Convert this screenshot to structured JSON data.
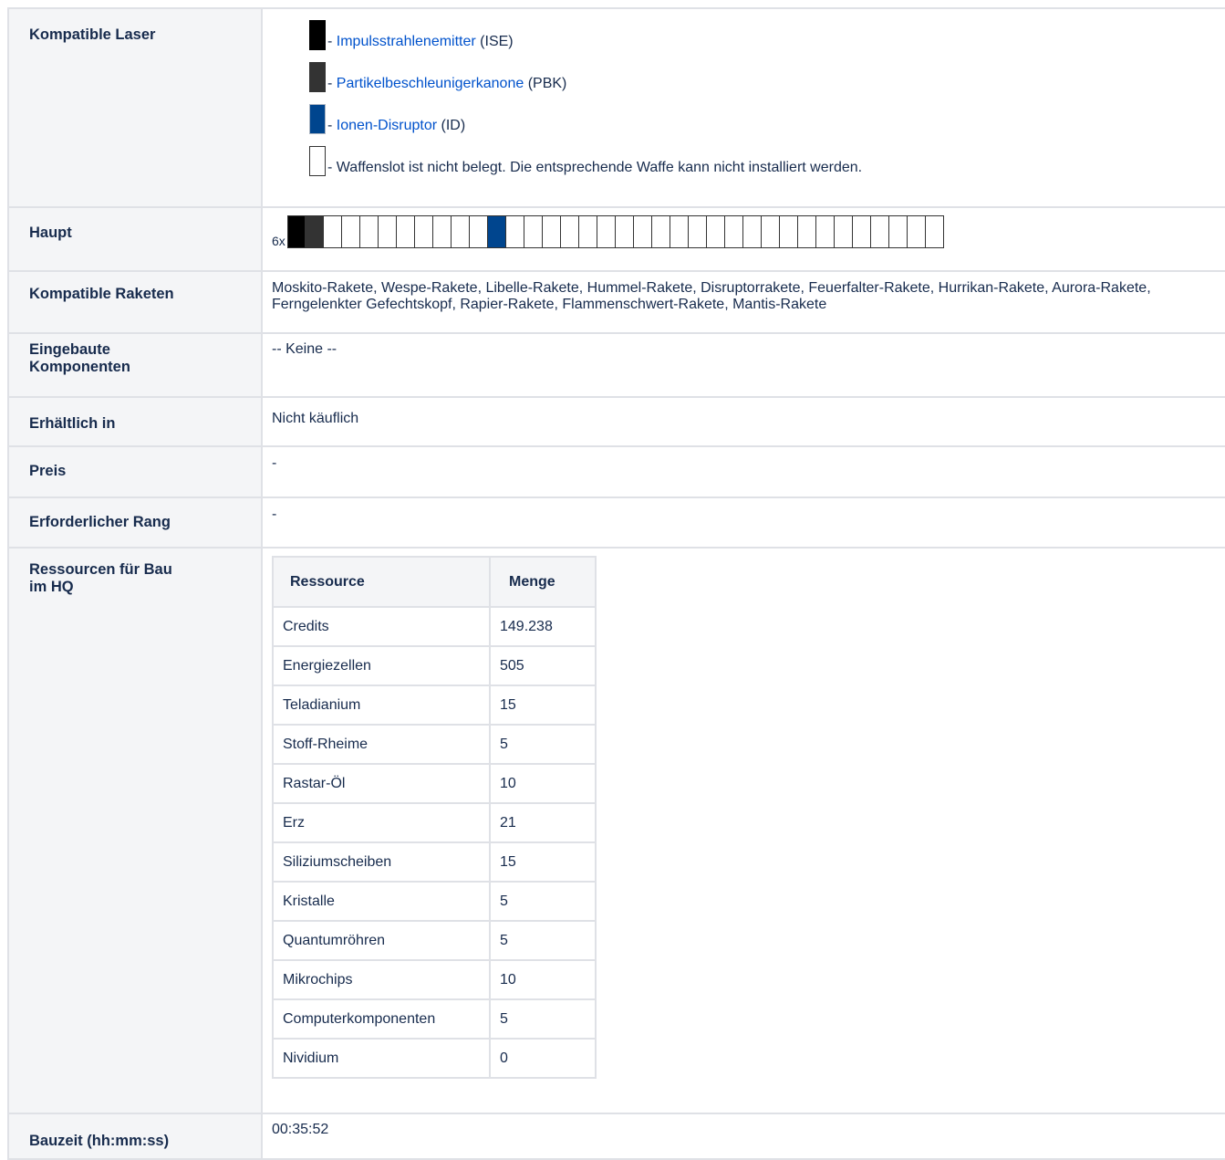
{
  "rows": {
    "kompatible_laser": {
      "label": "Kompatible Laser",
      "legend": [
        {
          "color": "#000000",
          "sep": "- ",
          "link": "Impulsstrahlenemitter",
          "suffix": " (ISE)"
        },
        {
          "color": "#333333",
          "sep": "- ",
          "link": "Partikelbeschleunigerkanone",
          "suffix": " (PBK)"
        },
        {
          "color": "#00458e",
          "sep": "- ",
          "link": "Ionen-Disruptor",
          "suffix": " (ID)"
        },
        {
          "color": "#ffffff",
          "sep": "- ",
          "text": "Waffenslot ist nicht belegt. Die entsprechende Waffe kann nicht installiert werden."
        }
      ]
    },
    "haupt": {
      "label": "Haupt",
      "count": "6x",
      "slots": [
        "#000000",
        "#333333",
        "#ffffff",
        "#ffffff",
        "#ffffff",
        "#ffffff",
        "#ffffff",
        "#ffffff",
        "#ffffff",
        "#ffffff",
        "#ffffff",
        "#00458e",
        "#ffffff",
        "#ffffff",
        "#ffffff",
        "#ffffff",
        "#ffffff",
        "#ffffff",
        "#ffffff",
        "#ffffff",
        "#ffffff",
        "#ffffff",
        "#ffffff",
        "#ffffff",
        "#ffffff",
        "#ffffff",
        "#ffffff",
        "#ffffff",
        "#ffffff",
        "#ffffff",
        "#ffffff",
        "#ffffff",
        "#ffffff",
        "#ffffff",
        "#ffffff",
        "#ffffff"
      ]
    },
    "raketen": {
      "label": "Kompatible Raketen",
      "value": "Moskito-Rakete, Wespe-Rakete, Libelle-Rakete, Hummel-Rakete, Disruptorrakete, Feuerfalter-Rakete, Hurrikan-Rakete, Aurora-Rakete, Ferngelenkter Gefechtskopf, Rapier-Rakete, Flammenschwert-Rakete, Mantis-Rakete"
    },
    "komponenten": {
      "label": "Eingebaute Komponenten",
      "value": "-- Keine --"
    },
    "erhaeltlich": {
      "label": "Erhältlich in",
      "value": "Nicht käuflich"
    },
    "preis": {
      "label": "Preis",
      "value": "-"
    },
    "rang": {
      "label": "Erforderlicher Rang",
      "value": "-"
    },
    "ressourcen": {
      "label": "Ressourcen für Bau im HQ",
      "header": {
        "name": "Ressource",
        "amount": "Menge"
      },
      "items": [
        {
          "name": "Credits",
          "amount": "149.238"
        },
        {
          "name": "Energiezellen",
          "amount": "505"
        },
        {
          "name": "Teladianium",
          "amount": "15"
        },
        {
          "name": "Stoff-Rheime",
          "amount": "5"
        },
        {
          "name": "Rastar-Öl",
          "amount": "10"
        },
        {
          "name": "Erz",
          "amount": "21"
        },
        {
          "name": "Siliziumscheiben",
          "amount": "15"
        },
        {
          "name": "Kristalle",
          "amount": "5"
        },
        {
          "name": "Quantumröhren",
          "amount": "5"
        },
        {
          "name": "Mikrochips",
          "amount": "10"
        },
        {
          "name": "Computerkomponenten",
          "amount": "5"
        },
        {
          "name": "Nividium",
          "amount": "0"
        }
      ]
    },
    "bauzeit": {
      "label": "Bauzeit (hh:mm:ss)",
      "value": "00:35:52"
    }
  }
}
